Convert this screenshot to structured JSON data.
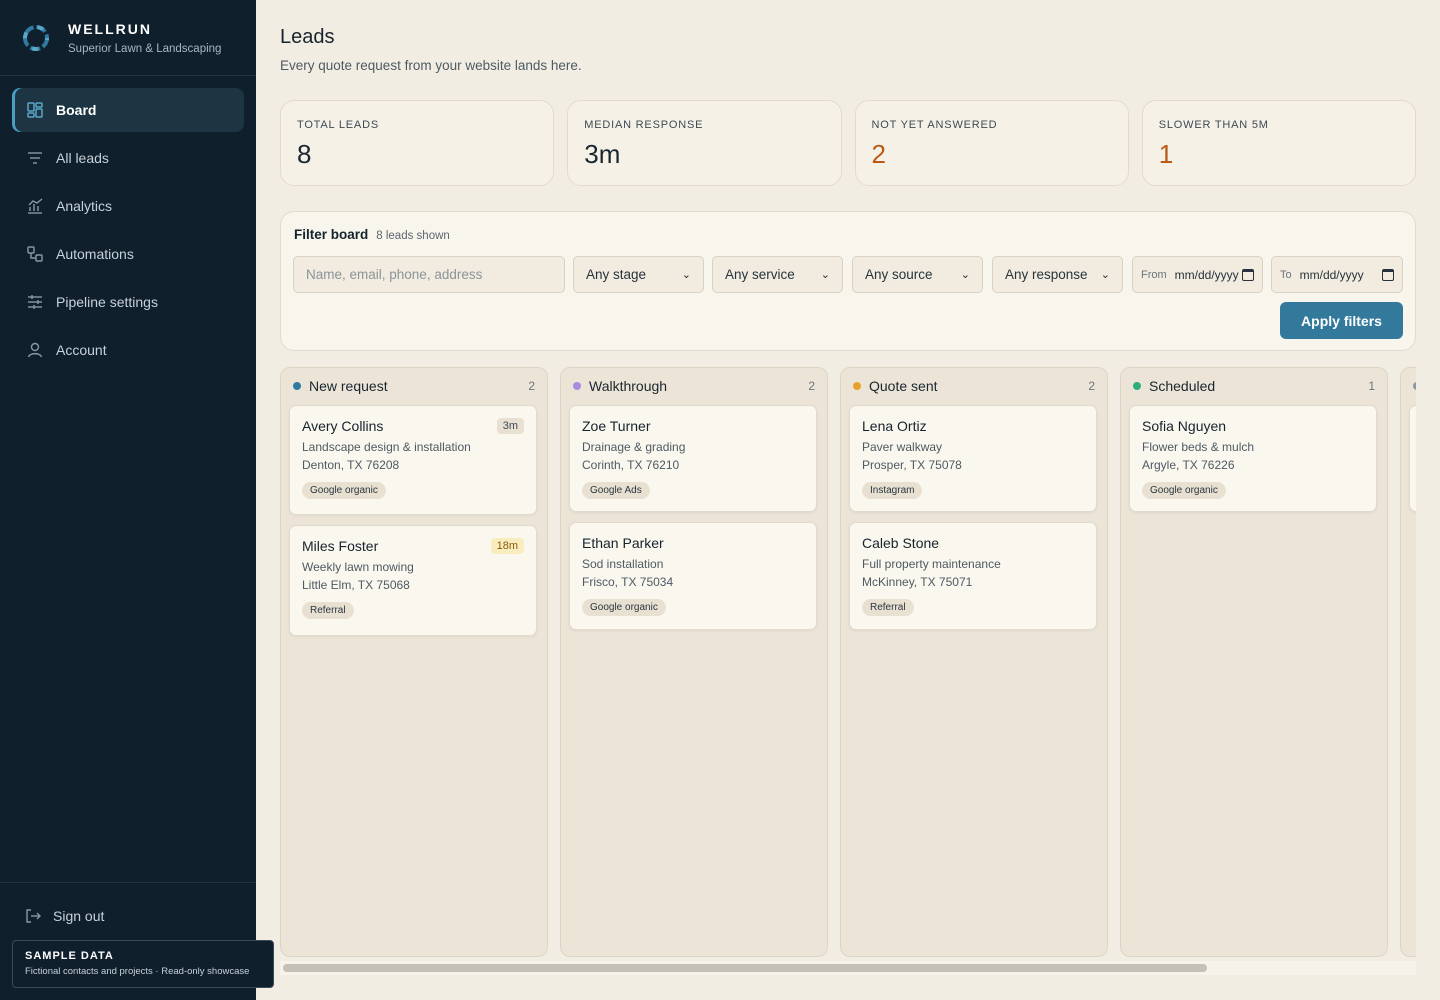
{
  "brand": {
    "name": "WELLRUN",
    "subtitle": "Superior Lawn & Landscaping"
  },
  "nav": [
    {
      "label": "Board",
      "icon": "board-grid-icon",
      "active": true
    },
    {
      "label": "All leads",
      "icon": "filter-list-icon"
    },
    {
      "label": "Analytics",
      "icon": "analytics-chart-icon"
    },
    {
      "label": "Automations",
      "icon": "automations-icon"
    },
    {
      "label": "Pipeline settings",
      "icon": "sliders-icon"
    },
    {
      "label": "Account",
      "icon": "user-icon"
    }
  ],
  "footer": {
    "signout_label": "Sign out",
    "sample_title": "SAMPLE DATA",
    "sample_desc": "Fictional contacts and projects · Read-only showcase"
  },
  "header": {
    "title": "Leads",
    "subtitle": "Every quote request from your website lands here."
  },
  "stats": [
    {
      "label": "TOTAL LEADS",
      "value": "8"
    },
    {
      "label": "MEDIAN RESPONSE",
      "value": "3m"
    },
    {
      "label": "NOT YET ANSWERED",
      "value": "2",
      "accent": "#b85a14"
    },
    {
      "label": "SLOWER THAN 5M",
      "value": "1",
      "accent": "#b85a14"
    }
  ],
  "filter": {
    "title": "Filter board",
    "count": "8 leads shown",
    "search_placeholder": "Name, email, phone, address",
    "stage": "Any stage",
    "service": "Any service",
    "source": "Any source",
    "response": "Any response",
    "from_label": "From",
    "from_value": "mm/dd/yyyy",
    "to_label": "To",
    "to_value": "mm/dd/yyyy",
    "apply_label": "Apply filters"
  },
  "columns": [
    {
      "title": "New request",
      "count": "2",
      "color": "#2f7aa0",
      "cards": [
        {
          "name": "Avery Collins",
          "service": "Landscape design & installation",
          "address": "Denton, TX 76208",
          "source": "Google organic",
          "time": "3m",
          "late": false
        },
        {
          "name": "Miles Foster",
          "service": "Weekly lawn mowing",
          "address": "Little Elm, TX 75068",
          "source": "Referral",
          "time": "18m",
          "late": true
        }
      ]
    },
    {
      "title": "Walkthrough",
      "count": "2",
      "color": "#a98be0",
      "cards": [
        {
          "name": "Zoe Turner",
          "service": "Drainage & grading",
          "address": "Corinth, TX 76210",
          "source": "Google Ads"
        },
        {
          "name": "Ethan Parker",
          "service": "Sod installation",
          "address": "Frisco, TX 75034",
          "source": "Google organic"
        }
      ]
    },
    {
      "title": "Quote sent",
      "count": "2",
      "color": "#e9a12e",
      "cards": [
        {
          "name": "Lena Ortiz",
          "service": "Paver walkway",
          "address": "Prosper, TX 75078",
          "source": "Instagram"
        },
        {
          "name": "Caleb Stone",
          "service": "Full property maintenance",
          "address": "McKinney, TX 75071",
          "source": "Referral"
        }
      ]
    },
    {
      "title": "Scheduled",
      "count": "1",
      "color": "#2eae7a",
      "cards": [
        {
          "name": "Sofia Nguyen",
          "service": "Flower beds & mulch",
          "address": "Argyle, TX 76226",
          "source": "Google organic"
        }
      ]
    }
  ]
}
